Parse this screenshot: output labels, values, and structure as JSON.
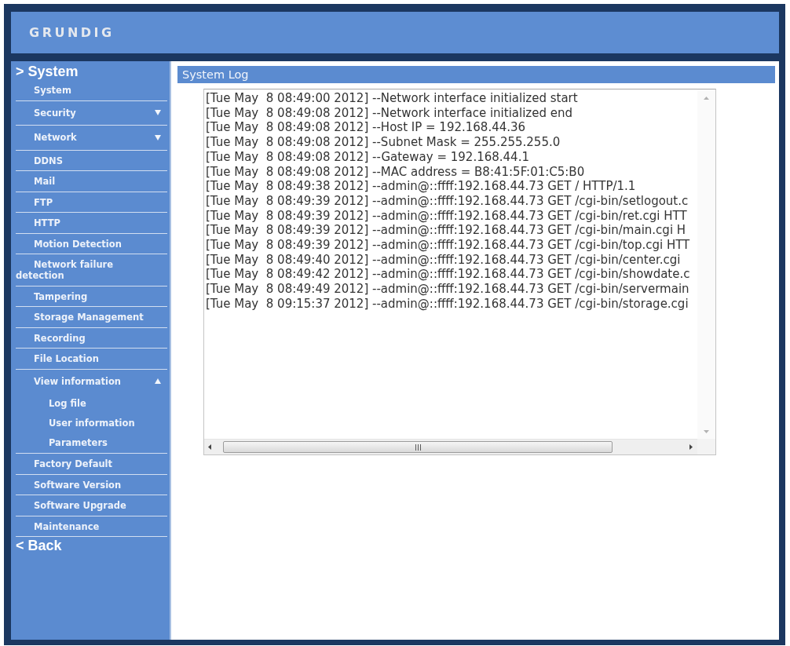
{
  "header": {
    "logo": "GRUNDIG"
  },
  "sidebar": {
    "section": "> System",
    "items": [
      {
        "label": "System",
        "kind": "link"
      },
      {
        "label": "Security",
        "kind": "group",
        "expanded": false
      },
      {
        "label": "Network",
        "kind": "group",
        "expanded": false
      },
      {
        "label": "DDNS",
        "kind": "link"
      },
      {
        "label": "Mail",
        "kind": "link"
      },
      {
        "label": "FTP",
        "kind": "link"
      },
      {
        "label": "HTTP",
        "kind": "link"
      },
      {
        "label": "Motion Detection",
        "kind": "link"
      },
      {
        "label": "Network failure detection",
        "kind": "link"
      },
      {
        "label": "Tampering",
        "kind": "link"
      },
      {
        "label": "Storage Management",
        "kind": "link"
      },
      {
        "label": "Recording",
        "kind": "link"
      },
      {
        "label": "File Location",
        "kind": "link"
      },
      {
        "label": "View information",
        "kind": "group",
        "expanded": true,
        "children": [
          {
            "label": "Log file"
          },
          {
            "label": "User information"
          },
          {
            "label": "Parameters"
          }
        ]
      },
      {
        "label": "Factory Default",
        "kind": "link"
      },
      {
        "label": "Software Version",
        "kind": "link"
      },
      {
        "label": "Software Upgrade",
        "kind": "link"
      },
      {
        "label": "Maintenance",
        "kind": "link"
      }
    ],
    "back": "< Back"
  },
  "panel": {
    "title": "System Log",
    "log_lines": [
      "[Tue May  8 08:49:00 2012] --Network interface initialized start",
      "[Tue May  8 08:49:08 2012] --Network interface initialized end",
      "[Tue May  8 08:49:08 2012] --Host IP = 192.168.44.36",
      "[Tue May  8 08:49:08 2012] --Subnet Mask = 255.255.255.0",
      "[Tue May  8 08:49:08 2012] --Gateway = 192.168.44.1",
      "[Tue May  8 08:49:08 2012] --MAC address = B8:41:5F:01:C5:B0",
      "[Tue May  8 08:49:38 2012] --admin@::ffff:192.168.44.73 GET / HTTP/1.1",
      "[Tue May  8 08:49:39 2012] --admin@::ffff:192.168.44.73 GET /cgi-bin/setlogout.c",
      "[Tue May  8 08:49:39 2012] --admin@::ffff:192.168.44.73 GET /cgi-bin/ret.cgi HTT",
      "[Tue May  8 08:49:39 2012] --admin@::ffff:192.168.44.73 GET /cgi-bin/main.cgi H",
      "[Tue May  8 08:49:39 2012] --admin@::ffff:192.168.44.73 GET /cgi-bin/top.cgi HTT",
      "[Tue May  8 08:49:40 2012] --admin@::ffff:192.168.44.73 GET /cgi-bin/center.cgi",
      "[Tue May  8 08:49:42 2012] --admin@::ffff:192.168.44.73 GET /cgi-bin/showdate.c",
      "[Tue May  8 08:49:49 2012] --admin@::ffff:192.168.44.73 GET /cgi-bin/servermain",
      "[Tue May  8 09:15:37 2012] --admin@::ffff:192.168.44.73 GET /cgi-bin/storage.cgi"
    ]
  }
}
